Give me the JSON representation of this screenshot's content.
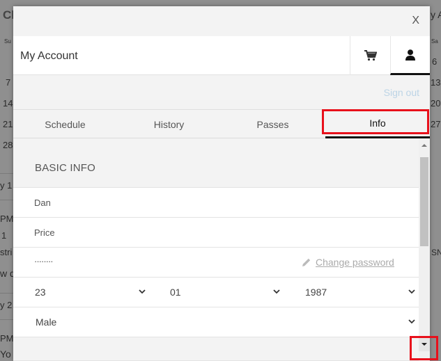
{
  "background": {
    "header_fragment": "Cl",
    "header_fragment_right": "y A",
    "day_head_left": "Su",
    "day_head_right": "Sa",
    "dates_left": [
      "7",
      "14",
      "21",
      "28"
    ],
    "dates_right": [
      "6",
      "13",
      "20",
      "27"
    ],
    "frag_day1": "y 1",
    "frag_pm1": "PM",
    "frag_1": "1",
    "frag_stri": "stri",
    "frag_wd": "w d",
    "frag_day2": "y 2",
    "frag_pm2": "PM",
    "frag_yo": "Yo",
    "frag_right": "SN"
  },
  "modal": {
    "close_label": "X",
    "title": "My Account",
    "signout_label": "Sign out",
    "tabs": [
      {
        "label": "Schedule"
      },
      {
        "label": "History"
      },
      {
        "label": "Passes"
      },
      {
        "label": "Info",
        "active": true
      }
    ],
    "section_title": "BASIC INFO",
    "first_name": "Dan",
    "last_name": "Price",
    "password_mask": "········",
    "change_password_label": "Change password",
    "birth_day": "23",
    "birth_month": "01",
    "birth_year": "1987",
    "gender": "Male"
  },
  "colors": {
    "highlight": "#e8101b",
    "signout": "#bcd4e6",
    "active_tab_underline": "#111111"
  }
}
